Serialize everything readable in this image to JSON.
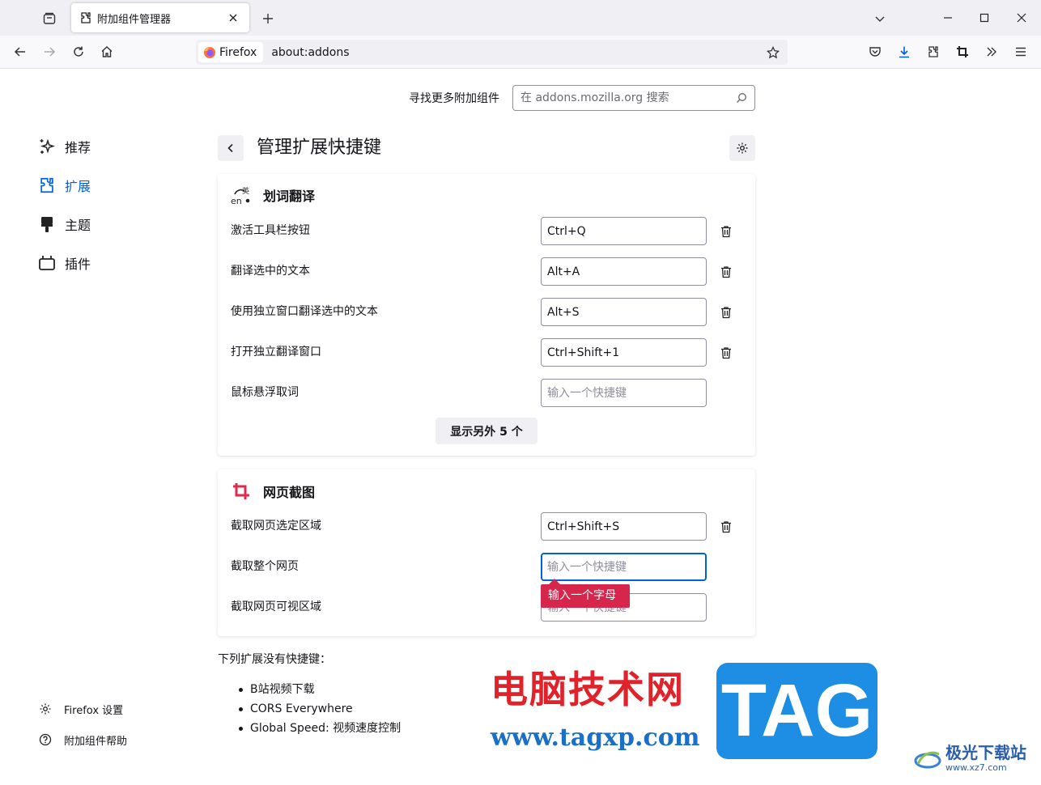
{
  "browser": {
    "tab_title": "附加组件管理器",
    "identity_label": "Firefox",
    "url": "about:addons"
  },
  "search": {
    "label": "寻找更多附加组件",
    "placeholder": "在 addons.mozilla.org 搜索"
  },
  "sidebar": {
    "items": [
      {
        "label": "推荐",
        "icon": "sparkle-icon"
      },
      {
        "label": "扩展",
        "icon": "puzzle-icon",
        "active": true
      },
      {
        "label": "主题",
        "icon": "paintbrush-icon"
      },
      {
        "label": "插件",
        "icon": "plugin-icon"
      }
    ],
    "footer": [
      {
        "label": "Firefox 设置",
        "icon": "gear-icon"
      },
      {
        "label": "附加组件帮助",
        "icon": "help-icon"
      }
    ]
  },
  "page_title": "管理扩展快捷键",
  "extensions": [
    {
      "name": "划词翻译",
      "icon": "translate-icon",
      "shortcuts": [
        {
          "label": "激活工具栏按钮",
          "value": "Ctrl+Q"
        },
        {
          "label": "翻译选中的文本",
          "value": "Alt+A"
        },
        {
          "label": "使用独立窗口翻译选中的文本",
          "value": "Alt+S"
        },
        {
          "label": "打开独立翻译窗口",
          "value": "Ctrl+Shift+1"
        },
        {
          "label": "鼠标悬浮取词",
          "value": "",
          "placeholder": "输入一个快捷键"
        }
      ],
      "more_button": "显示另外 5 个"
    },
    {
      "name": "网页截图",
      "icon": "crop-icon",
      "shortcuts": [
        {
          "label": "截取网页选定区域",
          "value": "Ctrl+Shift+S"
        },
        {
          "label": "截取整个网页",
          "value": "",
          "placeholder": "输入一个快捷键"
        },
        {
          "label": "截取网页可视区域",
          "value": "",
          "placeholder": "输入一个快捷键"
        }
      ]
    }
  ],
  "error_tooltip": "输入一个字母",
  "no_shortcuts": {
    "title": "下列扩展没有快捷键：",
    "items": [
      "B站视频下载",
      "CORS Everywhere",
      "Global Speed: 视频速度控制"
    ]
  },
  "watermark": {
    "cn_text": "电脑技术网",
    "url": "www.tagxp.com",
    "tag": "TAG",
    "site_name": "极光下载站",
    "site_domain": "www.xz7.com"
  },
  "colors": {
    "accent": "#0061e0",
    "error": "#d7264c",
    "crop_icon": "#e22850"
  }
}
